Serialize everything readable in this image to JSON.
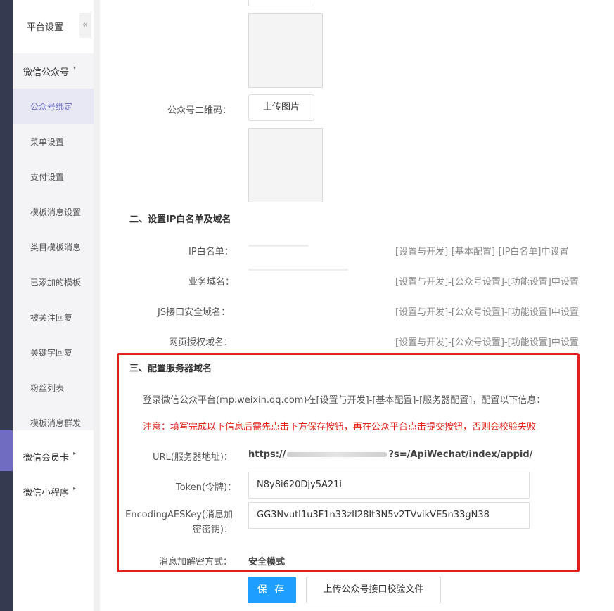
{
  "sidebar": {
    "title": "平台设置",
    "collapse_icon": "«",
    "groups": [
      {
        "label": "微信公众号",
        "arrow": "▾"
      },
      {
        "label": "微信会员卡",
        "arrow": "▸"
      },
      {
        "label": "微信小程序",
        "arrow": "▸"
      }
    ],
    "items": [
      {
        "label": "公众号绑定"
      },
      {
        "label": "菜单设置"
      },
      {
        "label": "支付设置"
      },
      {
        "label": "模板消息设置"
      },
      {
        "label": "类目模板消息"
      },
      {
        "label": "已添加的模板"
      },
      {
        "label": "被关注回复"
      },
      {
        "label": "关键字回复"
      },
      {
        "label": "粉丝列表"
      },
      {
        "label": "模板消息群发"
      }
    ]
  },
  "form": {
    "qrcode_label": "公众号二维码：",
    "upload_label": "上传图片"
  },
  "ip_section": {
    "title": "二、设置IP白名单及域名",
    "rows": [
      {
        "label": "IP白名单：",
        "hint": "[设置与开发]-[基本配置]-[IP白名单]中设置"
      },
      {
        "label": "业务域名：",
        "hint": "[设置与开发]-[公众号设置]-[功能设置]中设置"
      },
      {
        "label": "JS接口安全域名：",
        "hint": "[设置与开发]-[公众号设置]-[功能设置]中设置"
      },
      {
        "label": "网页授权域名：",
        "hint": "[设置与开发]-[公众号设置]-[功能设置]中设置"
      }
    ]
  },
  "server_section": {
    "title": "三、配置服务器域名",
    "intro": "登录微信公众平台(mp.weixin.qq.com)在[设置与开发]-[基本配置]-[服务器配置]，配置以下信息：",
    "warning": "注意：填写完成以下信息后需先点击下方保存按钮，再在公众平台点击提交按钮，否则会校验失败",
    "url_label": "URL(服务器地址)：",
    "url_prefix": "https://",
    "url_suffix": "?s=/ApiWechat/index/appid/",
    "token_label": "Token(令牌)：",
    "token_value": "N8y8i620Djy5A21i",
    "aes_label": "EncodingAESKey(消息加密密钥)：",
    "aes_value": "GG3NvutI1u3F1n33zII28It3N5v2TVvikVE5n33gN38",
    "mode_label": "消息加解密方式：",
    "mode_value": "安全模式"
  },
  "actions": {
    "save": "保 存",
    "verify_upload": "上传公众号接口校验文件"
  },
  "colors": {
    "accent": "#6a69c1",
    "primary": "#1e9fff",
    "warning": "#e2231a",
    "rail": "#353a50"
  }
}
